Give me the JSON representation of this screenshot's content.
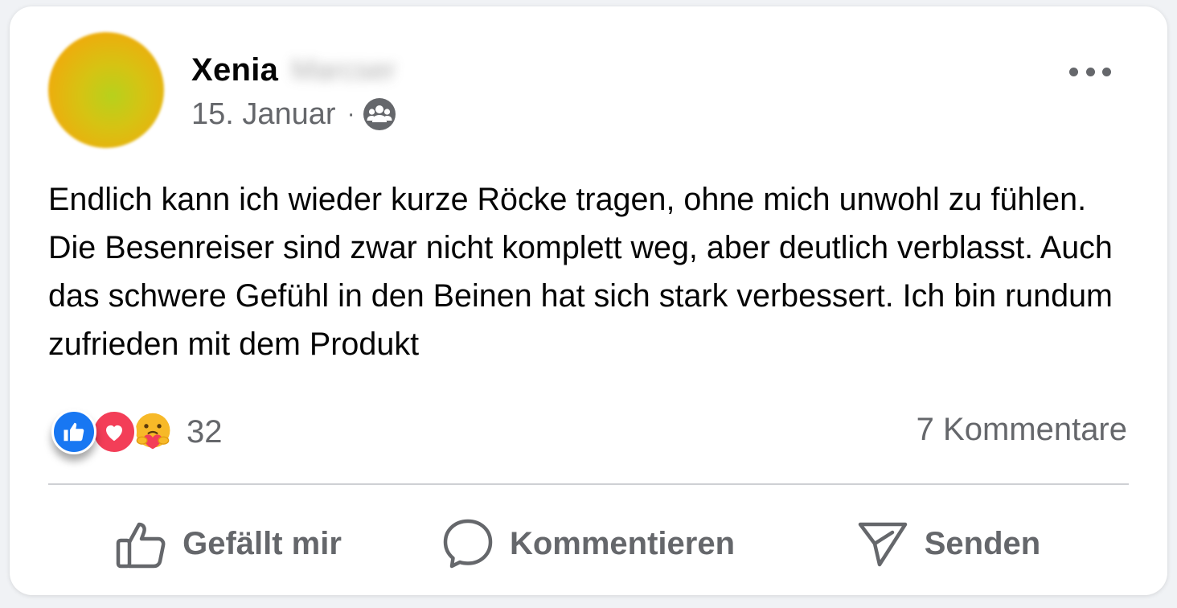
{
  "author": {
    "first_name": "Xenia",
    "surname_blurred": "Marcser",
    "avatar_color": "#d6c313"
  },
  "post": {
    "date": "15. Januar",
    "separator": "·",
    "audience_icon": "group-audience-icon",
    "text": "Endlich kann ich wieder kurze Röcke tragen, ohne mich unwohl zu fühlen. Die Besenreiser sind zwar nicht komplett weg, aber deutlich verblasst. Auch das schwere Gefühl in den Beinen hat sich stark verbessert. Ich bin rundum zufrieden mit dem Produkt"
  },
  "reactions": {
    "types": [
      "like",
      "love",
      "care"
    ],
    "count": "32",
    "colors": {
      "like": "#1877f2",
      "love": "#f33e58",
      "care": "#f7b928"
    }
  },
  "comments": {
    "label": "7 Kommentare"
  },
  "actions": {
    "like": {
      "label": "Gefällt mir",
      "icon": "thumbs-up-icon"
    },
    "comment": {
      "label": "Kommentieren",
      "icon": "speech-bubble-icon"
    },
    "send": {
      "label": "Senden",
      "icon": "send-icon"
    }
  },
  "colors": {
    "text": "#050505",
    "secondary": "#65676b",
    "divider": "#ced0d4"
  }
}
